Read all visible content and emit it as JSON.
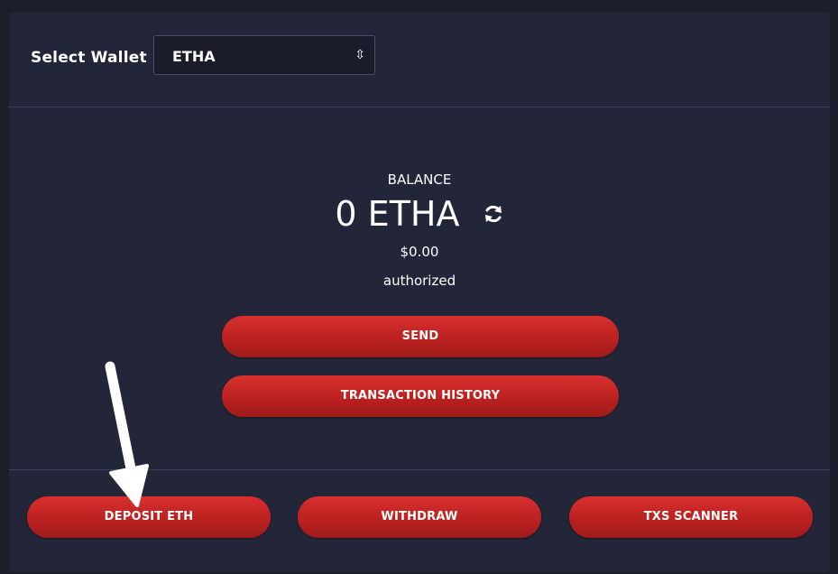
{
  "wallet": {
    "label": "Select Wallet",
    "selected": "ETHA",
    "arrows_icon": "up-down-arrows-icon"
  },
  "balance": {
    "label": "BALANCE",
    "amount": "0 ETHA",
    "refresh_icon": "refresh-icon",
    "fiat": "$0.00",
    "status": "authorized"
  },
  "actions": {
    "send": "SEND",
    "history": "TRANSACTION HISTORY",
    "deposit": "DEPOSIT ETH",
    "withdraw": "WITHDRAW",
    "scanner": "TXS SCANNER"
  },
  "colors": {
    "background": "#1c1e2b",
    "panel": "#232638",
    "button": "#c72726"
  }
}
